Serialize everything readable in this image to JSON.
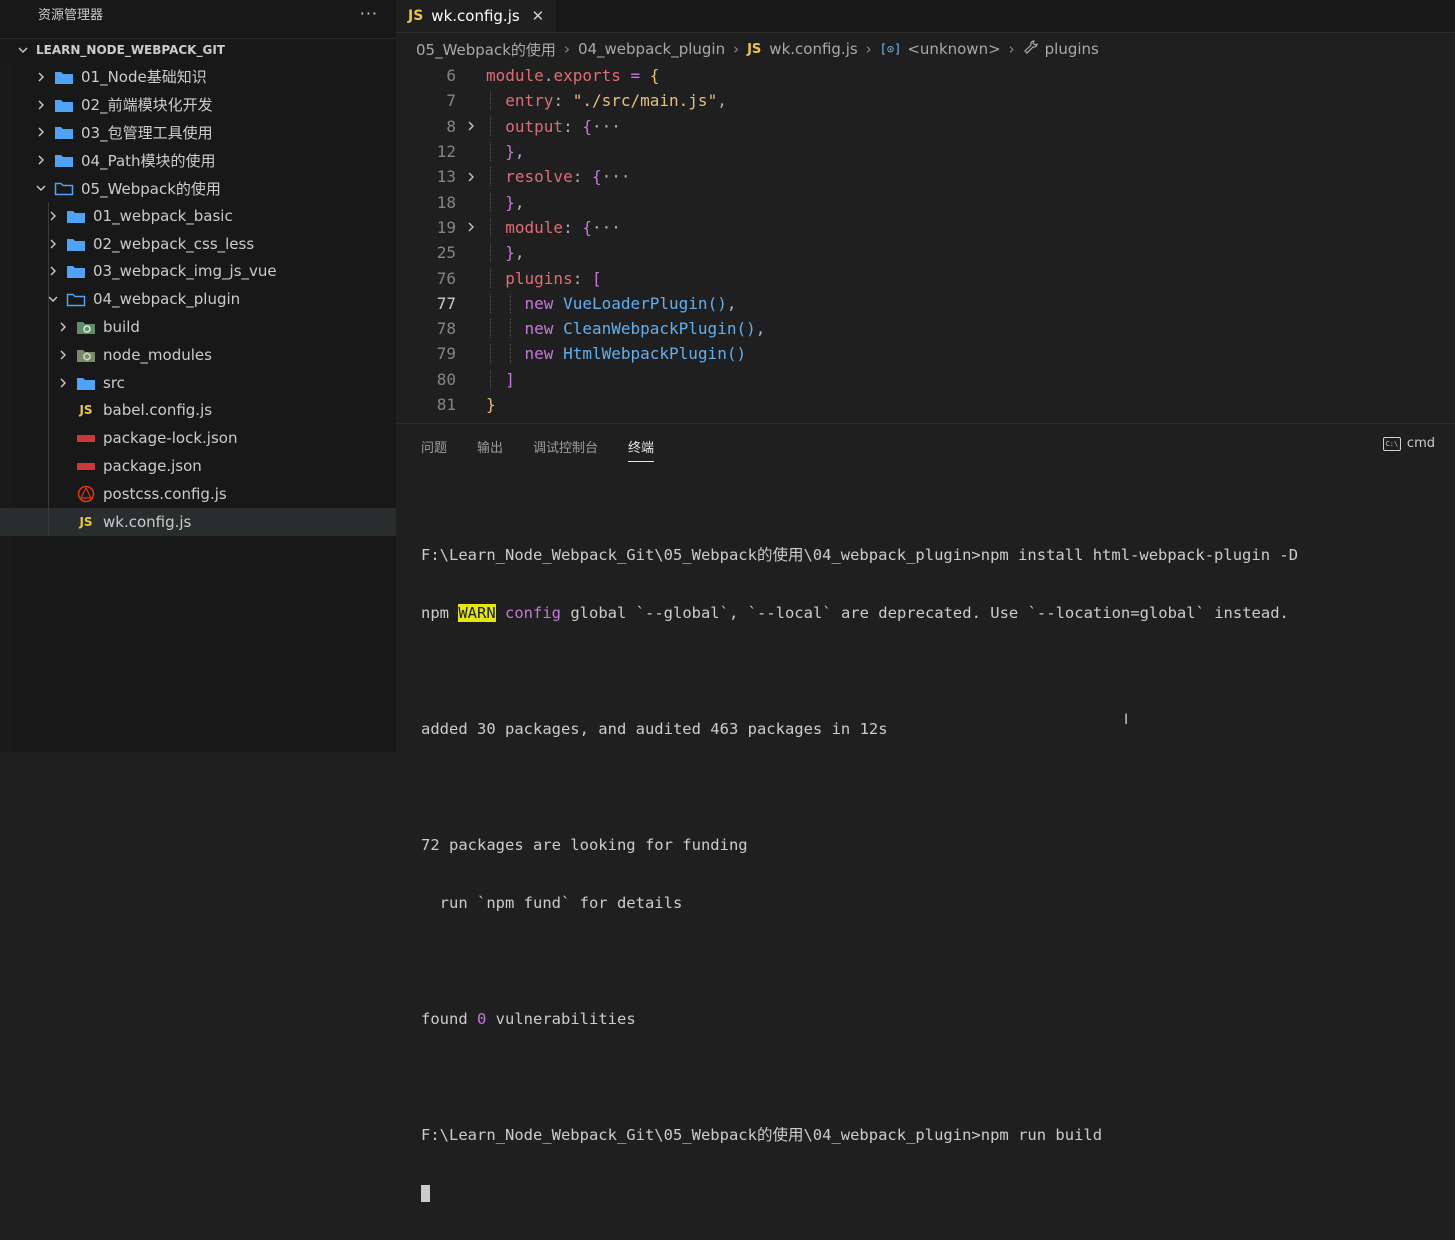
{
  "explorer": {
    "title": "资源管理器",
    "more": "···",
    "root": "LEARN_NODE_WEBPACK_GIT",
    "items": [
      {
        "label": "01_Node基础知识",
        "type": "folder",
        "expanded": false
      },
      {
        "label": "02_前端模块化开发",
        "type": "folder",
        "expanded": false
      },
      {
        "label": "03_包管理工具使用",
        "type": "folder",
        "expanded": false
      },
      {
        "label": "04_Path模块的使用",
        "type": "folder",
        "expanded": false
      },
      {
        "label": "05_Webpack的使用",
        "type": "folder",
        "expanded": true
      },
      {
        "label": "01_webpack_basic",
        "type": "folder",
        "expanded": false
      },
      {
        "label": "02_webpack_css_less",
        "type": "folder",
        "expanded": false
      },
      {
        "label": "03_webpack_img_js_vue",
        "type": "folder",
        "expanded": false
      },
      {
        "label": "04_webpack_plugin",
        "type": "folder",
        "expanded": true
      },
      {
        "label": "build",
        "type": "folder-special",
        "expanded": false
      },
      {
        "label": "node_modules",
        "type": "folder-special",
        "expanded": false
      },
      {
        "label": "src",
        "type": "folder",
        "expanded": false
      },
      {
        "label": "babel.config.js",
        "type": "js"
      },
      {
        "label": "package-lock.json",
        "type": "npm"
      },
      {
        "label": "package.json",
        "type": "npm"
      },
      {
        "label": "postcss.config.js",
        "type": "postcss"
      },
      {
        "label": "wk.config.js",
        "type": "js",
        "selected": true
      }
    ]
  },
  "editor": {
    "tab": {
      "badge": "JS",
      "label": "wk.config.js",
      "close": "✕"
    },
    "breadcrumb": {
      "parts": [
        "05_Webpack的使用",
        "04_webpack_plugin",
        "wk.config.js",
        "<unknown>",
        "plugins"
      ],
      "js_badge": "JS",
      "symbol_badge": "[⊙]"
    },
    "line_numbers": [
      "6",
      "7",
      "8",
      "12",
      "13",
      "18",
      "19",
      "25",
      "76",
      "77",
      "78",
      "79",
      "80",
      "81"
    ],
    "code": {
      "l6_a": "module",
      "l6_b": ".",
      "l6_c": "exports",
      "l6_d": " = ",
      "l6_e": "{",
      "l7_a": "entry",
      "l7_b": ": ",
      "l7_c": "\"./src/main.js\"",
      "l7_d": ",",
      "l8_a": "output",
      "l8_b": ": ",
      "l8_c": "{",
      "l8_d": "···",
      "l12_a": "}",
      "l12_b": ",",
      "l13_a": "resolve",
      "l13_b": ": ",
      "l13_c": "{",
      "l13_d": "···",
      "l18_a": "}",
      "l18_b": ",",
      "l19_a": "module",
      "l19_b": ": ",
      "l19_c": "{",
      "l19_d": "···",
      "l25_a": "}",
      "l25_b": ",",
      "l76_a": "plugins",
      "l76_b": ": ",
      "l76_c": "[",
      "l77_a": "new ",
      "l77_b": "VueLoaderPlugin",
      "l77_c": "()",
      "l77_d": ",",
      "l78_a": "new ",
      "l78_b": "CleanWebpackPlugin",
      "l78_c": "()",
      "l78_d": ",",
      "l79_a": "new ",
      "l79_b": "HtmlWebpackPlugin",
      "l79_c": "()",
      "l80_a": "]",
      "l81_a": "}"
    }
  },
  "panel": {
    "tabs": [
      "问题",
      "输出",
      "调试控制台",
      "终端"
    ],
    "active_tab": "终端",
    "shell_label": "cmd",
    "shell_icon_text": "C:\\",
    "terminal": {
      "line1": "F:\\Learn_Node_Webpack_Git\\05_Webpack的使用\\04_webpack_plugin>npm install html-webpack-plugin -D",
      "line2_a": "npm ",
      "line2_warn": "WARN",
      "line2_b": " ",
      "line2_config": "config",
      "line2_c": " global `--global`, `--local` are deprecated. Use `--location=global` instead.",
      "line3": "",
      "line4": "added 30 packages, and audited 463 packages in 12s",
      "line5": "",
      "line6": "72 packages are looking for funding",
      "line7": "  run `npm fund` for details",
      "line8": "",
      "line9_a": "found ",
      "line9_b": "0",
      "line9_c": " vulnerabilities",
      "line10": "",
      "line11": "F:\\Learn_Node_Webpack_Git\\05_Webpack的使用\\04_webpack_plugin>npm run build"
    }
  },
  "colors": {
    "folder": "#4fa3f7",
    "js_badge": "#e8c547",
    "npm": "#cb3837",
    "warn_bg": "#e5e510"
  }
}
